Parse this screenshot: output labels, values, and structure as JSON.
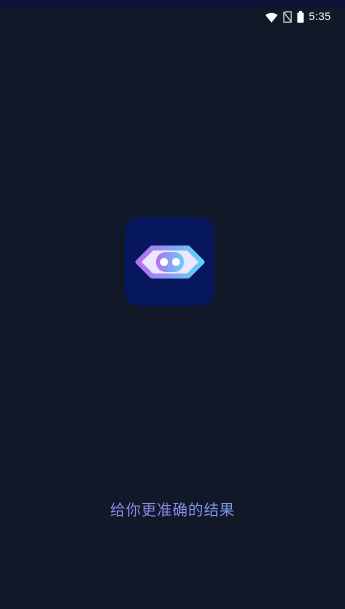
{
  "status_bar": {
    "time": "5:35",
    "icons": [
      "wifi-icon",
      "no-sim-icon",
      "battery-icon"
    ]
  },
  "splash": {
    "logo_icon": "robot-eye-logo-icon",
    "tagline": "给你更准确的结果"
  },
  "colors": {
    "background": "#111828",
    "icon_background": "#07175e",
    "gradient_start": "#b06ae6",
    "gradient_end": "#62b4e6"
  }
}
